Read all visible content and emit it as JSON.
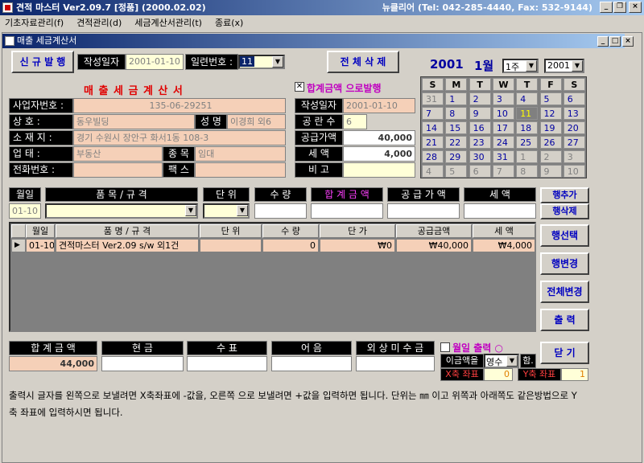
{
  "app": {
    "title": "견적 마스터 Ver2.09.7 [정품] (2000.02.02)",
    "contact": "뉴클리어 (Tel: 042-285-4440, Fax: 532-9144)"
  },
  "menu": [
    "기초자료관리(f)",
    "견적관리(d)",
    "세금계산서관리(t)",
    "종료(x)"
  ],
  "window": {
    "title": "매출 세금계산서"
  },
  "header": {
    "new_btn": "신 규 발 행",
    "date_label": "작성일자",
    "date_value": "2001-01-10",
    "serial_label": "일련번호 :",
    "serial_value": "11",
    "delete_all": "전 체 삭 제"
  },
  "form": {
    "title": "매 출 세 금 계 산 서",
    "total_issue": "합계금액 으로발행",
    "bizno_label": "사업자번호 :",
    "bizno": "135-06-29251",
    "company_label": "상      호 :",
    "company": "동우빌딩",
    "name_label": "성 명",
    "name": "이경희 외6",
    "address_label": "소  재  지 :",
    "address": "경기 수원시 장안구 화서1동 108-3",
    "type_label": "업      태 :",
    "type": "부동산",
    "item_label": "종 목",
    "item": "임대",
    "phone_label": "전화번호 :",
    "phone": "",
    "fax_label": "팩 스",
    "fax": "",
    "wdate_label": "작성일자",
    "wdate": "2001-01-10",
    "blank_label": "공 란 수",
    "blank": "6",
    "supply_label": "공급가액",
    "supply": "40,000",
    "tax_label": "세    액",
    "tax": "4,000",
    "memo_label": "비    고",
    "memo": ""
  },
  "calendar": {
    "year_label": "2001",
    "month_label": "1월",
    "week_sel": "1주",
    "year_sel": "2001",
    "days": [
      "S",
      "M",
      "T",
      "W",
      "T",
      "F",
      "S"
    ],
    "cells": [
      "31",
      "1",
      "2",
      "3",
      "4",
      "5",
      "6",
      "7",
      "8",
      "9",
      "10",
      "11",
      "12",
      "13",
      "14",
      "15",
      "16",
      "17",
      "18",
      "19",
      "20",
      "21",
      "22",
      "23",
      "24",
      "25",
      "26",
      "27",
      "28",
      "29",
      "30",
      "31",
      "1",
      "2",
      "3",
      "4",
      "5",
      "6",
      "7",
      "8",
      "9",
      "10"
    ]
  },
  "entry": {
    "h_date": "월일",
    "h_item": "품 목 / 규 격",
    "h_unit": "단 위",
    "h_qty": "수 량",
    "h_total": "합 계 금 액",
    "h_supply": "공 급 가 액",
    "h_tax": "세    액",
    "date": "01-10",
    "add_row": "행추가",
    "del_row": "행삭제"
  },
  "grid": {
    "headers": [
      "월일",
      "품 명 / 규 격",
      "단 위",
      "수 량",
      "단 가",
      "공급금액",
      "세 액"
    ],
    "rows": [
      [
        "01-10",
        "견적마스터 Ver2.09 s/w 외1건",
        "",
        "0",
        "₩0",
        "₩40,000",
        "₩4,000"
      ]
    ]
  },
  "side": {
    "select": "행선택",
    "change": "행변경",
    "change_all": "전체변경",
    "print": "출    력",
    "close": "닫  기"
  },
  "totals": {
    "h_total": "합 계 금 액",
    "h_cash": "현         금",
    "h_check": "수         표",
    "h_note": "어         음",
    "h_credit": "외 상 미 수 금",
    "total": "44,000"
  },
  "print_opts": {
    "monthly": "월일 출력 ○",
    "amount_label": "이금액을",
    "receipt": "영수",
    "suffix": "함.",
    "x_label": "X축 좌표",
    "x": "0",
    "y_label": "Y축 좌표",
    "y": "1"
  },
  "note": "출력시 글자를 왼쪽으로 보낼려면 X축좌표에 -값을, 오른쪽 으로 보낼려면 +값을 입력하면 됩니다. 단위는 ㎜ 이고 위쪽과 아래쪽도 같은방법으로 Y축 좌표에 입력하시면 됩니다."
}
